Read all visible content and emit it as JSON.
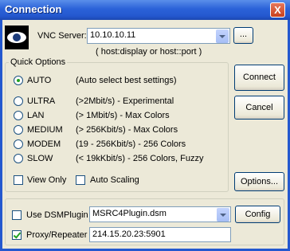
{
  "window": {
    "title": "Connection",
    "close_label": "X"
  },
  "server": {
    "label": "VNC Server:",
    "value": "10.10.10.11",
    "browse_label": "...",
    "hint": "( host:display or host::port )"
  },
  "quick_options": {
    "title": "Quick Options",
    "selected": "AUTO",
    "options": [
      {
        "name": "AUTO",
        "desc": "(Auto select best settings)"
      },
      {
        "name": "ULTRA",
        "desc": "(>2Mbit/s) - Experimental"
      },
      {
        "name": "LAN",
        "desc": "(> 1Mbit/s) - Max Colors"
      },
      {
        "name": "MEDIUM",
        "desc": "(> 256Kbit/s) - Max Colors"
      },
      {
        "name": "MODEM",
        "desc": "(19 - 256Kbit/s) - 256 Colors"
      },
      {
        "name": "SLOW",
        "desc": "(< 19kKbit/s) - 256 Colors, Fuzzy"
      }
    ],
    "view_only": {
      "label": "View Only",
      "checked": false
    },
    "auto_scaling": {
      "label": "Auto Scaling",
      "checked": false
    }
  },
  "buttons": {
    "connect": "Connect",
    "cancel": "Cancel",
    "options": "Options...",
    "config": "Config"
  },
  "plugin": {
    "label": "Use DSMPlugin",
    "checked": false,
    "value": "MSRC4Plugin.dsm"
  },
  "proxy": {
    "label": "Proxy/Repeater",
    "checked": true,
    "value": "214.15.20.23:5901"
  }
}
